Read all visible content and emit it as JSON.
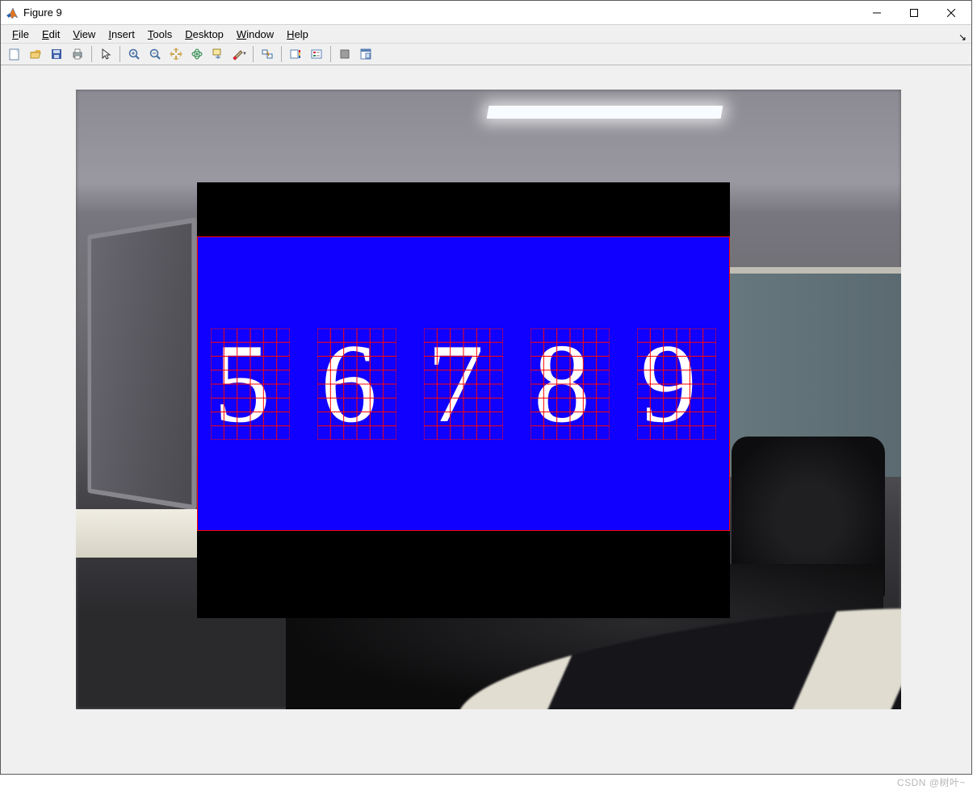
{
  "window": {
    "title": "Figure 9"
  },
  "menus": {
    "file": "File",
    "edit": "Edit",
    "view": "View",
    "insert": "Insert",
    "tools": "Tools",
    "desktop": "Desktop",
    "window": "Window",
    "help": "Help"
  },
  "toolbar_icons": {
    "new": "new-figure-icon",
    "open": "open-icon",
    "save": "save-icon",
    "print": "print-icon",
    "pointer": "pointer-icon",
    "zoom_in": "zoom-in-icon",
    "zoom_out": "zoom-out-icon",
    "pan": "pan-icon",
    "rotate": "rotate-3d-icon",
    "datatip": "data-cursor-icon",
    "brush": "brush-icon",
    "link": "link-plots-icon",
    "colorbar": "colorbar-icon",
    "legend": "legend-icon",
    "hide_tools": "hide-tools-icon",
    "dock": "dock-icon"
  },
  "figure": {
    "digits": [
      "5",
      "6",
      "7",
      "8",
      "9"
    ],
    "overlay_color": "#1000ff",
    "grid_color": "#ff0000"
  },
  "watermark": "CSDN @树叶~"
}
